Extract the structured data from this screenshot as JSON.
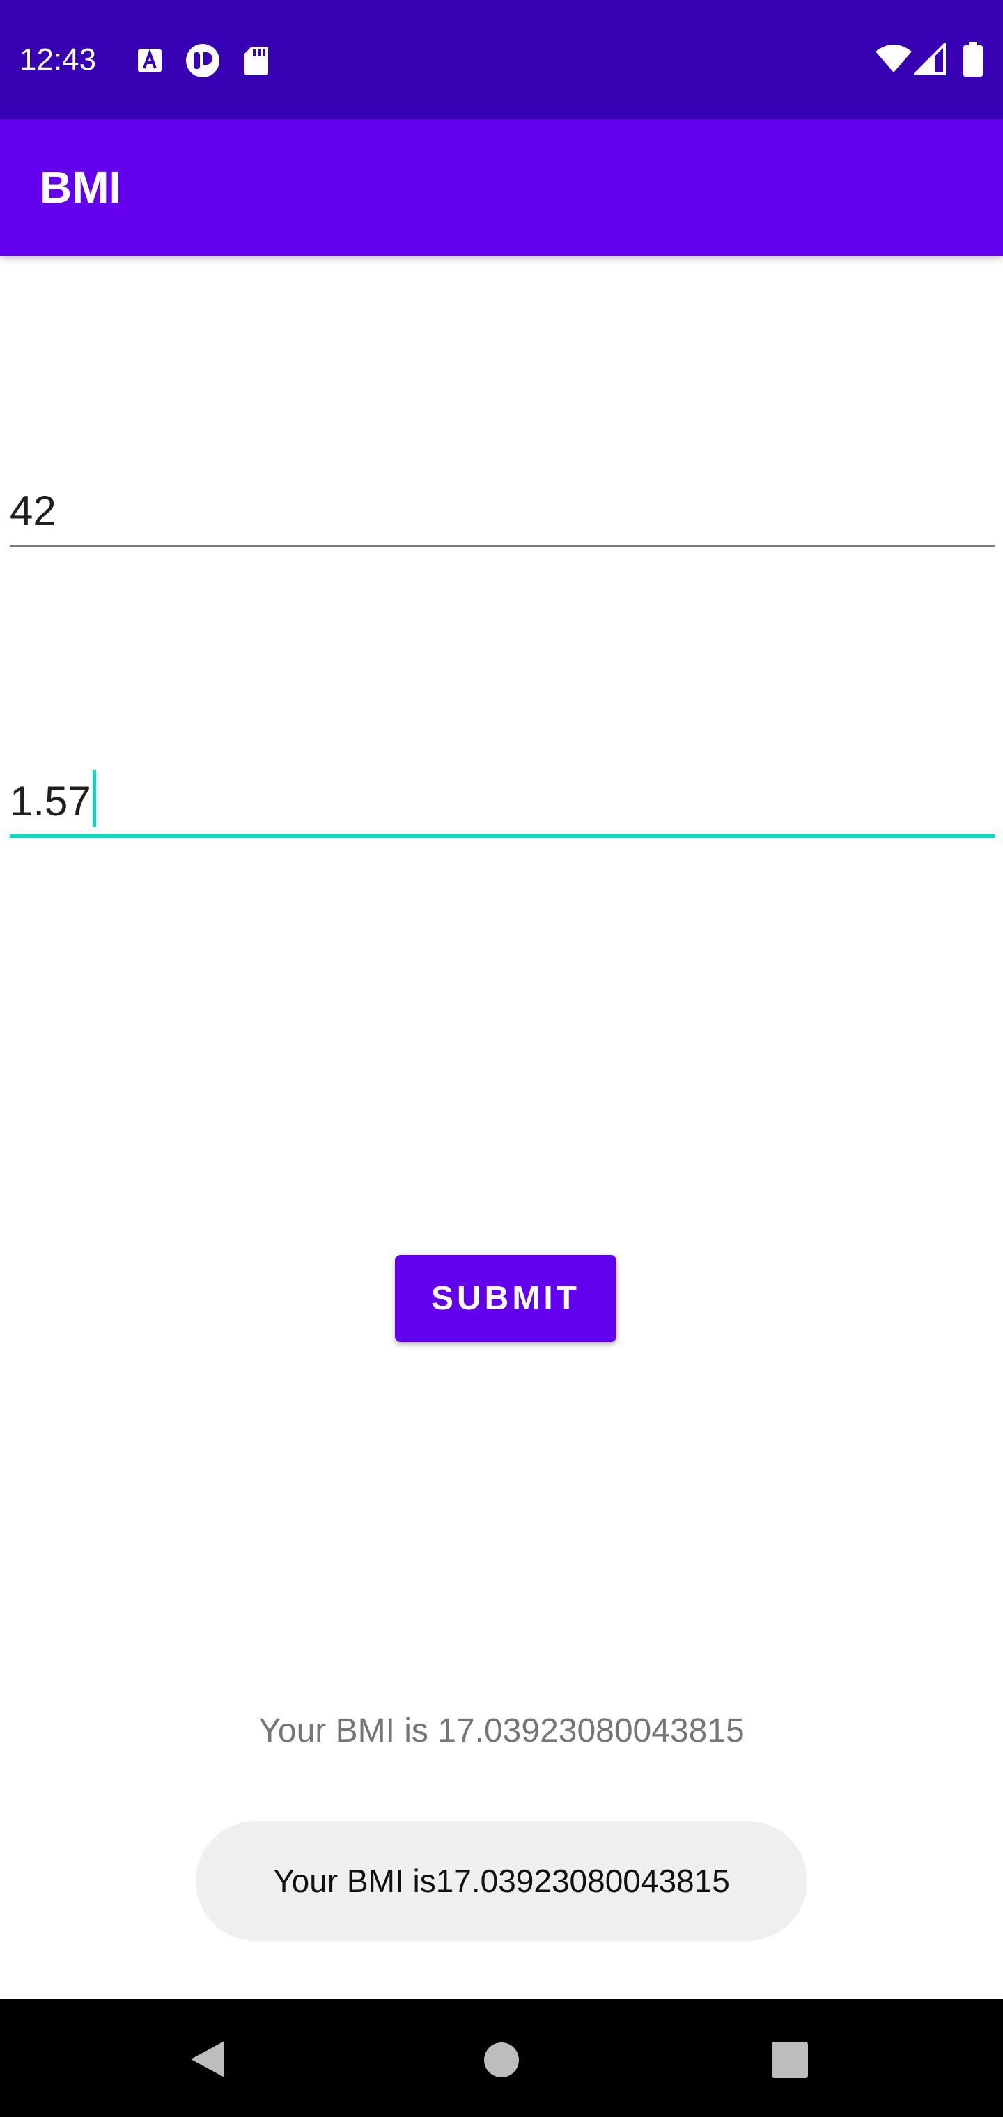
{
  "status_bar": {
    "time": "12:43",
    "left_icons": [
      "a-notification-icon",
      "app-notification-icon",
      "sd-card-icon"
    ],
    "right_icons": [
      "wifi-icon",
      "cell-signal-icon",
      "battery-icon"
    ]
  },
  "app_bar": {
    "title": "BMI"
  },
  "form": {
    "weight_value": "42",
    "height_value": "1.57",
    "submit_label": "SUBMIT"
  },
  "result": {
    "text": "Your BMI is 17.03923080043815"
  },
  "toast": {
    "text": "Your BMI is17.03923080043815"
  },
  "nav_bar": {
    "buttons": [
      "back-icon",
      "home-icon",
      "recents-icon"
    ]
  },
  "colors": {
    "status_bar": "#3700b3",
    "primary": "#6200ee",
    "accent": "#03dac5"
  }
}
